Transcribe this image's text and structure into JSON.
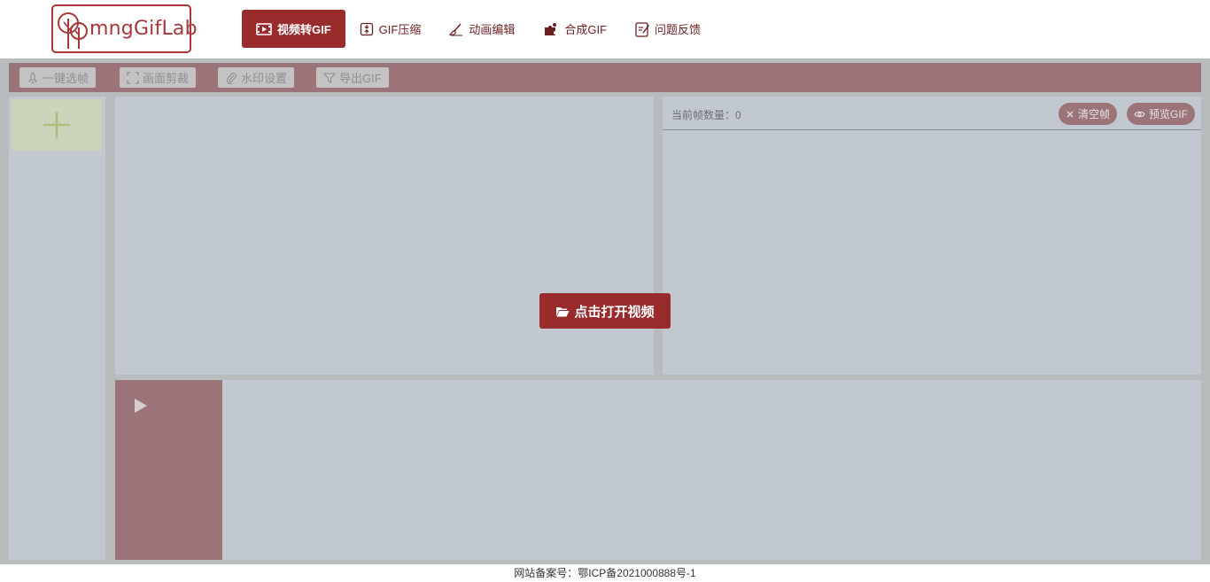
{
  "brand": {
    "logo_text": "mngGifLab"
  },
  "nav": {
    "items": [
      {
        "label": "视频转GIF",
        "icon": "film-icon",
        "active": true
      },
      {
        "label": "GIF压缩",
        "icon": "compress-icon",
        "active": false
      },
      {
        "label": "动画编辑",
        "icon": "brush-icon",
        "active": false
      },
      {
        "label": "合成GIF",
        "icon": "puzzle-icon",
        "active": false
      },
      {
        "label": "问题反馈",
        "icon": "feedback-icon",
        "active": false
      }
    ]
  },
  "toolbar": {
    "buttons": [
      {
        "label": "一键选帧",
        "icon": "rocket-icon"
      },
      {
        "label": "画面剪裁",
        "icon": "crop-icon"
      },
      {
        "label": "水印设置",
        "icon": "paperclip-icon"
      },
      {
        "label": "导出GIF",
        "icon": "filter-icon"
      }
    ]
  },
  "frames": {
    "count_label": "当前帧数量：",
    "count_value": "0",
    "clear_label": "清空帧",
    "preview_label": "预览GIF"
  },
  "video": {
    "open_label": "点击打开视频"
  },
  "footer": {
    "text": "网站备案号：鄂ICP备2021000888号-1"
  },
  "colors": {
    "brand": "#9a2b2d",
    "toolbar": "#9a7478",
    "panel": "#c2c8d0",
    "add_tile": "#cbd3b9"
  }
}
